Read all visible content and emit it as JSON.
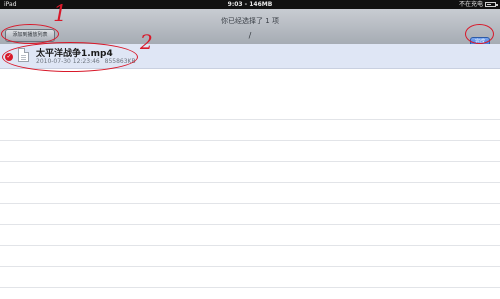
{
  "status_bar": {
    "carrier": "iPad",
    "time_storage": "9:03 - 146MB",
    "charging": "不在充电"
  },
  "navbar": {
    "title": "你已经选择了 1 项",
    "path": "/",
    "add_button_label": "添加到播放列表",
    "done_button_label": "完成"
  },
  "file_list": {
    "items": [
      {
        "name": "太平洋战争1.mp4",
        "date": "2010-07-30 12:23:46",
        "size": "855863KB",
        "selected": true
      }
    ]
  },
  "annotations": {
    "marker_1": "1",
    "marker_2": "2",
    "color": "#d8192a"
  },
  "colors": {
    "navbar": "#b4b9c0",
    "selected_row": "#dfe6f5",
    "done_button": "#2f67d6"
  }
}
